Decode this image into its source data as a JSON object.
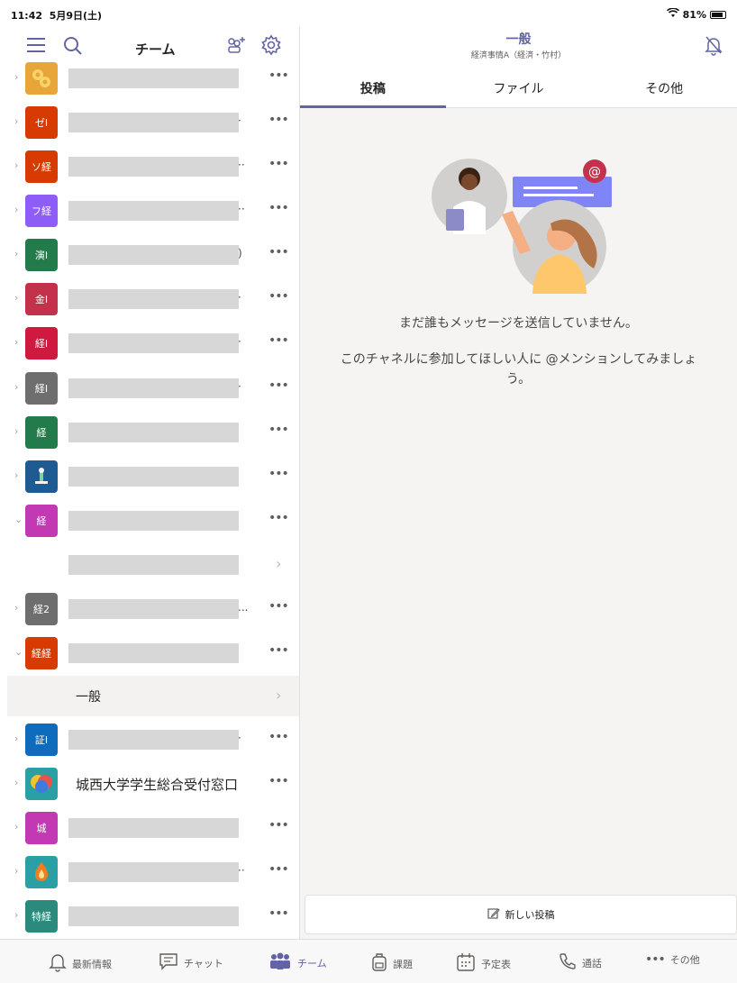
{
  "status": {
    "time": "11:42",
    "date": "5月9日(土)",
    "battery": "81%"
  },
  "sidebar": {
    "title": "チーム",
    "teams": [
      {
        "avatar": "",
        "color": "#e8a53a",
        "trail": ""
      },
      {
        "avatar": "ゼI",
        "color": "#d83b01",
        "trail": "·"
      },
      {
        "avatar": "ソ経",
        "color": "#d83b01",
        "trail": "··"
      },
      {
        "avatar": "フ経",
        "color": "#8e5cf7",
        "trail": "··"
      },
      {
        "avatar": "演I",
        "color": "#237b4b",
        "trail": ")"
      },
      {
        "avatar": "金I",
        "color": "#c4314b",
        "trail": "·"
      },
      {
        "avatar": "経I",
        "color": "#d0193f",
        "trail": "·"
      },
      {
        "avatar": "経I",
        "color": "#6e6e6e",
        "trail": "·"
      },
      {
        "avatar": "経",
        "color": "#237b4b",
        "trail": ""
      },
      {
        "avatar": "",
        "color": "#1f5b93",
        "trail": ""
      },
      {
        "avatar": "経",
        "color": "#c239b3",
        "trail": ""
      },
      {
        "avatar": "経2",
        "color": "#6e6e6e",
        "trail": "..."
      },
      {
        "avatar": "経経",
        "color": "#d83b01",
        "trail": ""
      },
      {
        "avatar": "証I",
        "color": "#0f6cbd",
        "trail": "·"
      },
      {
        "avatar": "",
        "color": "#2aa0a4",
        "trail": "",
        "name": "城西大学学生総合受付窓口"
      },
      {
        "avatar": "城",
        "color": "#c239b3",
        "trail": ""
      },
      {
        "avatar": "",
        "color": "#2aa0a4",
        "trail": "··"
      },
      {
        "avatar": "特経",
        "color": "#2a8a7c",
        "trail": ""
      }
    ],
    "channel_general": "一般"
  },
  "main": {
    "channel_title": "一般",
    "channel_subtitle": "経済事情A（経済・竹村）",
    "tabs": [
      "投稿",
      "ファイル",
      "その他"
    ],
    "empty_line1": "まだ誰もメッセージを送信していません。",
    "empty_line2": "このチャネルに参加してほしい人に @メンションしてみましょう。",
    "new_post": "新しい投稿"
  },
  "bottom_nav": [
    "最新情報",
    "チャット",
    "チーム",
    "課題",
    "予定表",
    "通話",
    "その他"
  ]
}
